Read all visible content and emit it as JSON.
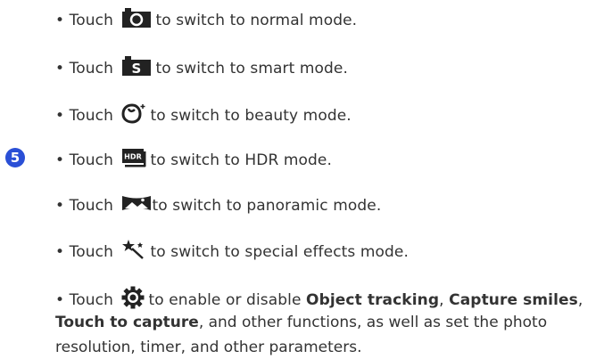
{
  "step_number": "5",
  "bullet": "•",
  "items": [
    {
      "prefix": "Touch",
      "icon": "camera-normal-icon",
      "suffix": "to switch to normal mode."
    },
    {
      "prefix": "Touch",
      "icon": "camera-smart-icon",
      "suffix": "to switch to smart mode."
    },
    {
      "prefix": "Touch",
      "icon": "beauty-icon",
      "suffix": "to switch to beauty mode."
    },
    {
      "prefix": "Touch",
      "icon": "hdr-icon",
      "suffix": "to switch to HDR mode."
    },
    {
      "prefix": "Touch",
      "icon": "panorama-icon",
      "suffix": "to switch to panoramic mode."
    },
    {
      "prefix": "Touch",
      "icon": "magic-wand-icon",
      "suffix": "to switch to special effects mode."
    },
    {
      "prefix": "Touch",
      "icon": "settings-gear-icon",
      "suffix": "to enable or disable"
    }
  ],
  "settings_text": {
    "bold1": "Object tracking",
    "sep1": ",",
    "bold2": "Capture smiles",
    "sep2": ",",
    "bold3": "Touch to capture",
    "rest_line2": ", and other functions, as well as set the photo",
    "line3": "resolution, timer, and other parameters."
  }
}
